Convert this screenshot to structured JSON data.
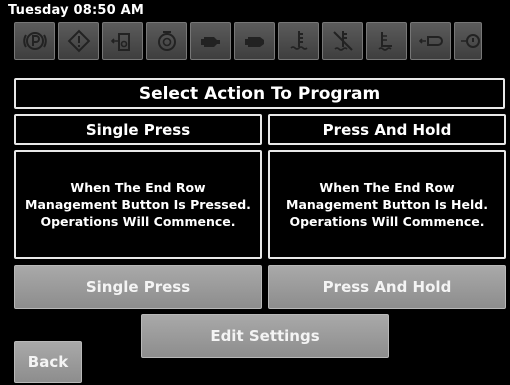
{
  "status": {
    "datetime": "Tuesday 08:50 AM"
  },
  "toolbar": {
    "icons": [
      "parking-brake-icon",
      "warning-icon",
      "hydraulic-fluid-icon",
      "transmission-oil-icon",
      "engine-icon",
      "engine-alt-icon",
      "coolant-icon",
      "coolant-alert-icon",
      "fuel-level-icon",
      "air-filter-icon",
      "oil-pressure-icon"
    ]
  },
  "main": {
    "title": "Select Action To Program",
    "options": [
      {
        "header": "Single Press",
        "description": [
          "When The End Row",
          "Management Button Is Pressed.",
          "Operations Will Commence."
        ],
        "button_label": "Single Press"
      },
      {
        "header": "Press And Hold",
        "description": [
          "When The End Row",
          "Management Button Is Held.",
          "Operations Will Commence."
        ],
        "button_label": "Press And Hold"
      }
    ],
    "edit_settings_label": "Edit Settings",
    "back_label": "Back"
  },
  "colors": {
    "background": "#000000",
    "border": "#e8e8e8",
    "button": "#9b9b9b",
    "icon_tile": "#4a4a4a"
  }
}
